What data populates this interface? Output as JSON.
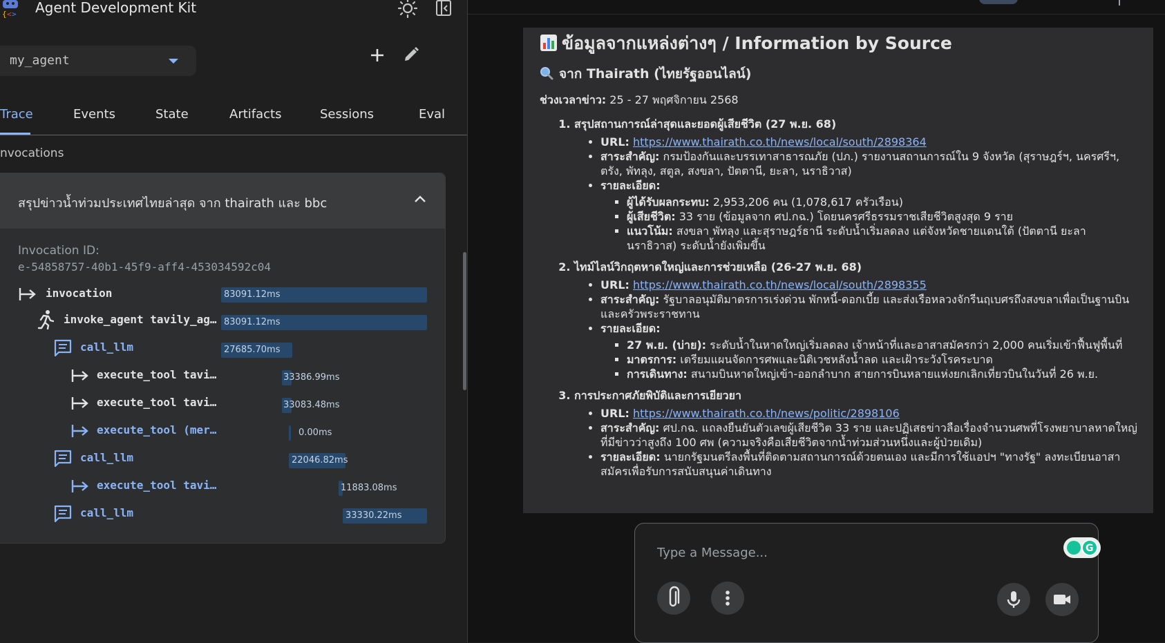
{
  "app": {
    "title": "Agent Development Kit"
  },
  "agent_select": {
    "value": "my_agent"
  },
  "tabs": [
    "Trace",
    "Events",
    "State",
    "Artifacts",
    "Sessions",
    "Eval"
  ],
  "trace": {
    "section_label": "Invocations",
    "visible_label": "nvocations",
    "invocation_query": "สรุปข่าวน้ำท่วมประเทศไทยล่าสุด จาก thairath และ bbc",
    "invocation_id_label": "Invocation ID:",
    "invocation_id": "e-54858757-40b1-45f9-aff4-453034592c04",
    "spans": [
      {
        "label": "invocation",
        "duration": "83091.12ms",
        "icon": "arrow-into-bar-icon"
      },
      {
        "label": "invoke_agent tavily_ag…",
        "duration": "83091.12ms",
        "icon": "running-person-icon"
      },
      {
        "label": "call_llm",
        "duration": "27685.70ms",
        "icon": "chat-message-icon"
      },
      {
        "label": "execute_tool tavi…",
        "duration": "33386.99ms",
        "icon": "arrow-into-bar-icon"
      },
      {
        "label": "execute_tool tavi…",
        "duration": "33083.48ms",
        "icon": "arrow-into-bar-icon"
      },
      {
        "label": "execute_tool (mer…",
        "duration": "0.00ms",
        "icon": "arrow-into-bar-icon"
      },
      {
        "label": "call_llm",
        "duration": "22046.82ms",
        "icon": "chat-message-icon"
      },
      {
        "label": "execute_tool tavi…",
        "duration": "11883.08ms",
        "icon": "arrow-into-bar-icon"
      },
      {
        "label": "call_llm",
        "duration": "33330.22ms",
        "icon": "chat-message-icon"
      }
    ]
  },
  "message": {
    "heading": "ข้อมูลจากแหล่งต่างๆ / Information by Source",
    "subheading": "จาก Thairath (ไทยรัฐออนไลน์)",
    "period_label": "ช่วงเวลาข่าว:",
    "period_value": "25 - 27 พฤศจิกายน 2568",
    "items": [
      {
        "title": "สรุปสถานการณ์ล่าสุดและยอดผู้เสียชีวิต (27 พ.ย. 68)",
        "url_label": "URL:",
        "url": "https://www.thairath.co.th/news/local/south/2898364",
        "summary_label": "สาระสำคัญ:",
        "summary": "กรมป้องกันและบรรเทาสาธารณภัย (ปภ.) รายงานสถานการณ์ใน 9 จังหวัด (สุราษฎร์ฯ, นครศรีฯ, ตรัง, พัทลุง, สตูล, สงขลา, ปัตตานี, ยะลา, นราธิวาส)",
        "details_label": "รายละเอียด:",
        "details": [
          {
            "k": "ผู้ได้รับผลกระทบ:",
            "v": "2,953,206 คน (1,078,617 ครัวเรือน)"
          },
          {
            "k": "ผู้เสียชีวิต:",
            "v": "33 ราย (ข้อมูลจาก ศป.กฉ.) โดยนครศรีธรรมราชเสียชีวิตสูงสุด 9 ราย"
          },
          {
            "k": "แนวโน้ม:",
            "v": "สงขลา พัทลุง และสุราษฎร์ธานี ระดับน้ำเริ่มลดลง แต่จังหวัดชายแดนใต้ (ปัตตานี ยะลา นราธิวาส) ระดับน้ำยังเพิ่มขึ้น"
          }
        ]
      },
      {
        "title": "ไทม์ไลน์วิกฤตหาดใหญ่และการช่วยเหลือ (26-27 พ.ย. 68)",
        "url_label": "URL:",
        "url": "https://www.thairath.co.th/news/local/south/2898355",
        "summary_label": "สาระสำคัญ:",
        "summary": "รัฐบาลอนุมัติมาตรการเร่งด่วน พักหนี้-ดอกเบี้ย และส่งเรือหลวงจักรีนฤเบศรถึงสงขลาเพื่อเป็นฐานบินและครัวพระราชทาน",
        "details_label": "รายละเอียด:",
        "details": [
          {
            "k": "27 พ.ย. (บ่าย):",
            "v": "ระดับน้ำในหาดใหญ่เริ่มลดลง เจ้าหน้าที่และอาสาสมัครกว่า 2,000 คนเริ่มเข้าฟื้นฟูพื้นที่"
          },
          {
            "k": "มาตรการ:",
            "v": "เตรียมแผนจัดการศพและนิติเวชหลังน้ำลด และเฝ้าระวังโรคระบาด"
          },
          {
            "k": "การเดินทาง:",
            "v": "สนามบินหาดใหญ่เข้า-ออกลำบาก สายการบินหลายแห่งยกเลิกเที่ยวบินในวันที่ 26 พ.ย."
          }
        ]
      },
      {
        "title": "การประกาศภัยพิบัติและการเยียวยา",
        "url_label": "URL:",
        "url": "https://www.thairath.co.th/news/politic/2898106",
        "summary_label": "สาระสำคัญ:",
        "summary": "ศป.กฉ. แถลงยืนยันตัวเลขผู้เสียชีวิต 33 ราย และปฏิเสธข่าวลือเรื่องจำนวนศพที่โรงพยาบาลหาดใหญ่ที่มีข่าวว่าสูงถึง 100 ศพ (ความจริงคือเสียชีวิตจากน้ำท่วมส่วนหนึ่งและผู้ป่วยเดิม)",
        "details_label": "รายละเอียด:",
        "details_text": "นายกรัฐมนตรีลงพื้นที่ติดตามสถานการณ์ด้วยตนเอง และมีการใช้แอปฯ \"ทางรัฐ\" ลงทะเบียนอาสาสมัครเพื่อรับการสนับสนุนค่าเดินทาง"
      }
    ]
  },
  "composer": {
    "placeholder": "Type a Message..."
  }
}
